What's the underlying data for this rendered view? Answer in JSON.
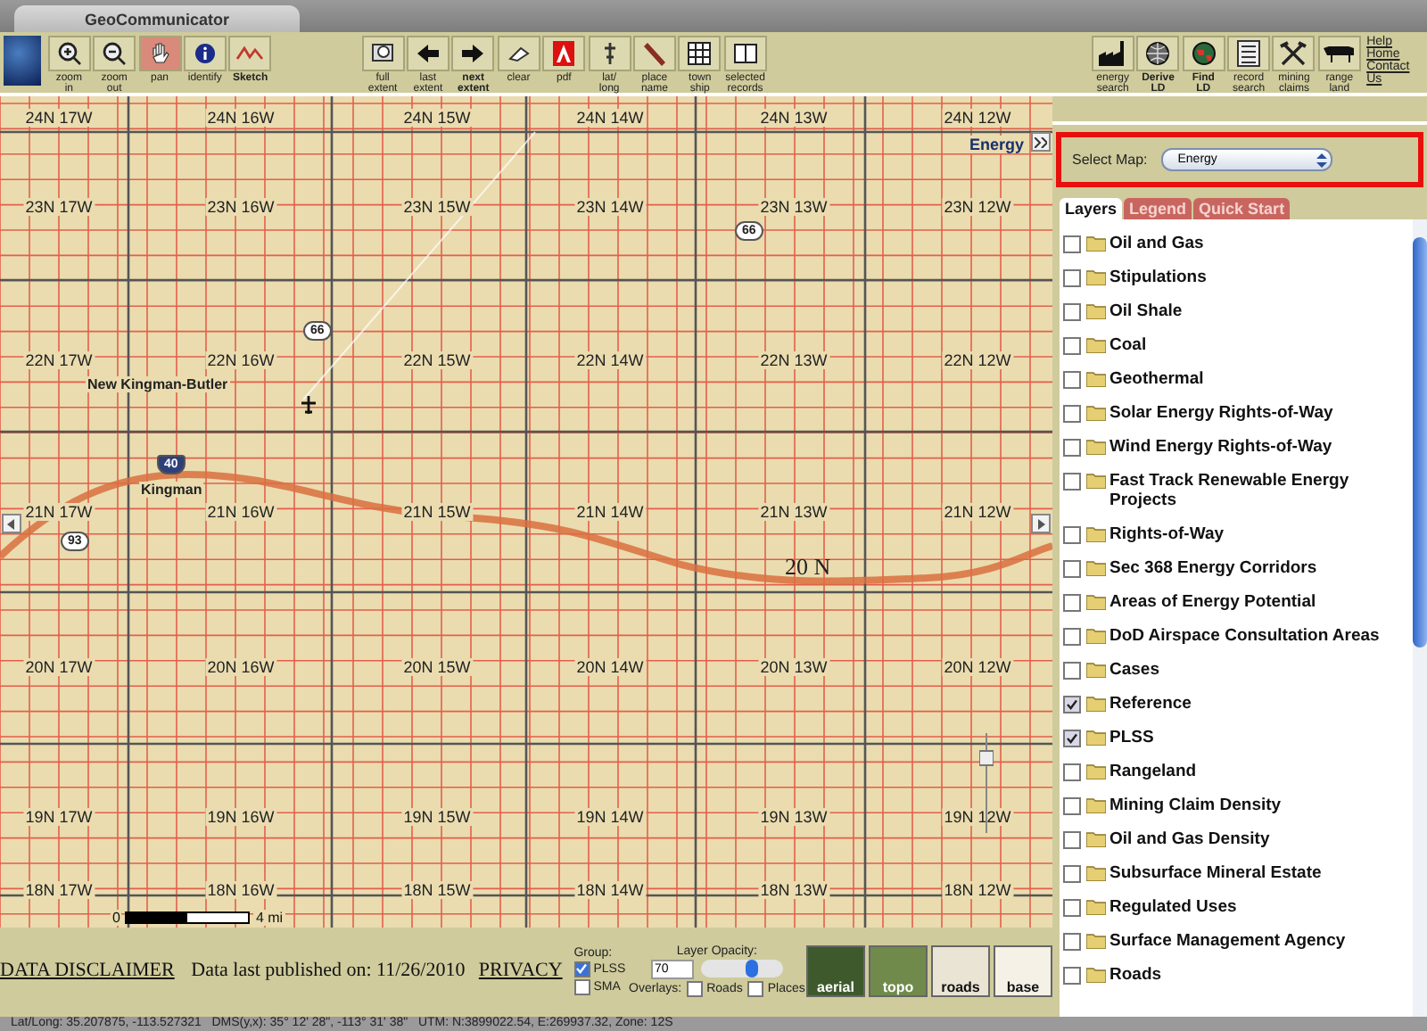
{
  "window": {
    "tab_title": "GeoCommunicator"
  },
  "toolbar": {
    "left_tools": [
      {
        "label": "zoom\nin",
        "selected": false,
        "bold": false
      },
      {
        "label": "zoom\nout",
        "selected": false,
        "bold": false
      },
      {
        "label": "pan",
        "selected": true,
        "bold": false
      },
      {
        "label": "identify",
        "selected": false,
        "bold": false
      },
      {
        "label": "Sketch",
        "selected": false,
        "bold": true
      }
    ],
    "center_tools": [
      {
        "label": "full\nextent",
        "bold": false
      },
      {
        "label": "last\nextent",
        "bold": false
      },
      {
        "label": "next\nextent",
        "bold": true
      },
      {
        "label": "clear",
        "bold": false
      },
      {
        "label": "pdf",
        "bold": false
      },
      {
        "label": "lat/\nlong",
        "bold": false
      },
      {
        "label": "place\nname",
        "bold": false
      },
      {
        "label": "town\nship",
        "bold": false
      },
      {
        "label": "selected\nrecords",
        "bold": false
      }
    ],
    "right_tools": [
      {
        "label": "energy\nsearch",
        "bold": false
      },
      {
        "label": "Derive\nLD",
        "bold": true
      },
      {
        "label": "Find\nLD",
        "bold": true
      },
      {
        "label": "record\nsearch",
        "bold": false
      },
      {
        "label": "mining\nclaims",
        "bold": false
      },
      {
        "label": "range\nland",
        "bold": false
      }
    ],
    "links": [
      "Help",
      "Home",
      "Contact Us"
    ]
  },
  "map": {
    "township_rows": [
      [
        "24N 17W",
        "24N 16W",
        "24N 15W",
        "24N 14W",
        "24N 13W",
        "24N 12W"
      ],
      [
        "23N 17W",
        "23N 16W",
        "23N 15W",
        "23N 14W",
        "23N 13W",
        "23N 12W"
      ],
      [
        "22N 17W",
        "22N 16W",
        "22N 15W",
        "22N 14W",
        "22N 13W",
        "22N 12W"
      ],
      [
        "21N 17W",
        "21N 16W",
        "21N 15W",
        "21N 14W",
        "21N 13W",
        "21N 12W"
      ],
      [
        "20N 17W",
        "20N 16W",
        "20N 15W",
        "20N 14W",
        "20N 13W",
        "20N 12W"
      ],
      [
        "19N 17W",
        "19N 16W",
        "19N 15W",
        "19N 14W",
        "19N 13W",
        "19N 12W"
      ],
      [
        "18N 17W",
        "18N 16W",
        "18N 15W",
        "18N 14W",
        "18N 13W",
        "18N 12W"
      ]
    ],
    "places": [
      "New Kingman-Butler",
      "Kingman"
    ],
    "route_shields": [
      {
        "kind": "us",
        "label": "66"
      },
      {
        "kind": "us",
        "label": "66"
      },
      {
        "kind": "interstate",
        "label": "40"
      },
      {
        "kind": "us",
        "label": "93"
      }
    ],
    "baseline_label": "20 N",
    "map_name": "Energy",
    "scale": {
      "start": "0",
      "end": "4 mi"
    }
  },
  "panel": {
    "select_label": "Select Map:",
    "select_value": "Energy",
    "tabs": [
      {
        "label": "Layers",
        "selected": true
      },
      {
        "label": "Legend",
        "selected": false
      },
      {
        "label": "Quick Start",
        "selected": false
      }
    ],
    "layers": [
      {
        "label": "Oil and Gas",
        "checked": false
      },
      {
        "label": "Stipulations",
        "checked": false
      },
      {
        "label": "Oil Shale",
        "checked": false
      },
      {
        "label": "Coal",
        "checked": false
      },
      {
        "label": "Geothermal",
        "checked": false
      },
      {
        "label": "Solar Energy Rights-of-Way",
        "checked": false
      },
      {
        "label": "Wind Energy Rights-of-Way",
        "checked": false
      },
      {
        "label": "Fast Track Renewable Energy Projects",
        "checked": false
      },
      {
        "label": "Rights-of-Way",
        "checked": false
      },
      {
        "label": "Sec 368 Energy Corridors",
        "checked": false
      },
      {
        "label": "Areas of Energy Potential",
        "checked": false
      },
      {
        "label": "DoD Airspace Consultation Areas",
        "checked": false
      },
      {
        "label": "Cases",
        "checked": false
      },
      {
        "label": "Reference",
        "checked": true
      },
      {
        "label": "PLSS",
        "checked": true
      },
      {
        "label": "Rangeland",
        "checked": false
      },
      {
        "label": "Mining Claim Density",
        "checked": false
      },
      {
        "label": "Oil and Gas Density",
        "checked": false
      },
      {
        "label": "Subsurface Mineral Estate",
        "checked": false
      },
      {
        "label": "Regulated Uses",
        "checked": false
      },
      {
        "label": "Surface Management Agency",
        "checked": false
      },
      {
        "label": "Roads",
        "checked": false
      }
    ]
  },
  "footer": {
    "disclaimer_link": "DATA DISCLAIMER",
    "published": "Data last published on: 11/26/2010",
    "privacy_link": "PRIVACY",
    "group_label": "Group:",
    "groups": [
      {
        "label": "PLSS",
        "checked": true
      },
      {
        "label": "SMA",
        "checked": false
      }
    ],
    "opacity_label": "Layer Opacity:",
    "opacity_value": "70",
    "opacity": {
      "level": 0.6
    },
    "overlays_label": "Overlays:",
    "overlays": [
      {
        "label": "Roads",
        "checked": false
      },
      {
        "label": "Places",
        "checked": false
      }
    ],
    "basemaps": [
      {
        "label": "aerial",
        "kind": "aerial"
      },
      {
        "label": "topo",
        "kind": "topo"
      },
      {
        "label": "roads",
        "kind": "roads"
      },
      {
        "label": "base",
        "kind": "base"
      }
    ]
  },
  "status_bar": "Lat/Long: 35.207875, -113.527321   DMS(y,x): 35° 12' 28\", -113° 31' 38\"   UTM: N:3899022.54, E:269937.32, Zone: 12S"
}
